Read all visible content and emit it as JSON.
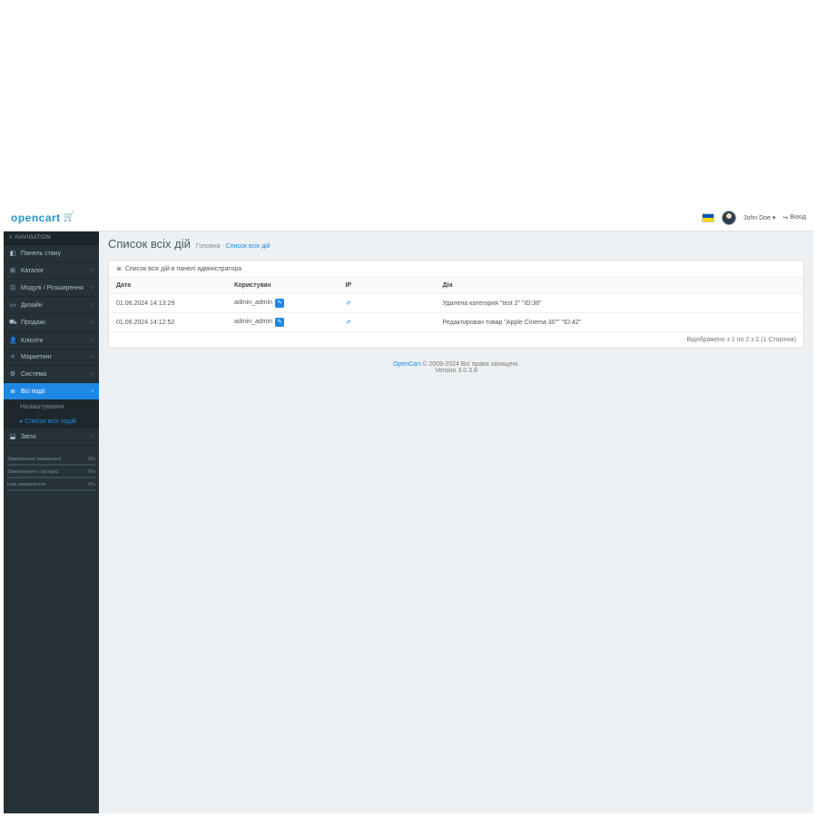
{
  "logo": "opencart",
  "user": {
    "name": "John Doe",
    "exit": "Вихід"
  },
  "nav_header": "NAVIGATION",
  "sidebar": [
    {
      "icon": "◧",
      "label": "Панель стану",
      "expandable": false,
      "key": "dashboard"
    },
    {
      "icon": "⊞",
      "label": "Каталог",
      "expandable": true,
      "key": "catalog"
    },
    {
      "icon": "⊡",
      "label": "Модулі / Розширення",
      "expandable": true,
      "key": "extensions"
    },
    {
      "icon": "▭",
      "label": "Дизайн",
      "expandable": true,
      "key": "design"
    },
    {
      "icon": "⛟",
      "label": "Продажі",
      "expandable": true,
      "key": "sales"
    },
    {
      "icon": "👤",
      "label": "Клієнти",
      "expandable": true,
      "key": "customers"
    },
    {
      "icon": "<",
      "label": "Маркетинг",
      "expandable": true,
      "key": "marketing"
    },
    {
      "icon": "⚙",
      "label": "Система",
      "expandable": true,
      "key": "system"
    },
    {
      "icon": "≣",
      "label": "Всі події",
      "expandable": true,
      "key": "allevents",
      "active": true
    },
    {
      "icon": "⬓",
      "label": "Звіти",
      "expandable": true,
      "key": "reports"
    }
  ],
  "submenu": [
    {
      "label": "Налаштування",
      "active": false,
      "key": "settings"
    },
    {
      "label": "Список всіх подій",
      "active": true,
      "key": "eventlist"
    }
  ],
  "stats": [
    {
      "label": "Замовлення завершені",
      "value": "0%"
    },
    {
      "label": "Замовлення у процесі",
      "value": "0%"
    },
    {
      "label": "Інші замовлення",
      "value": "0%"
    }
  ],
  "page": {
    "title": "Список всіх дій",
    "bc_home": "Головна",
    "bc_sep": " · ",
    "bc_current": "Список всіх дій"
  },
  "panel": {
    "head": "Список всіх дій в панелі адміністратора",
    "columns": {
      "date": "Дата",
      "user": "Користувач",
      "ip": "IP",
      "action": "Дія"
    },
    "rows": [
      {
        "date": "01.06.2024 14:13:29",
        "user": "admin_admin",
        "action": "Удалена категория \"test 2\" \"ID:36\""
      },
      {
        "date": "01.06.2024 14:12:52",
        "user": "admin_admin",
        "action": "Редактирован товар \"Apple Cinema 30\"\" \"ID:42\""
      }
    ],
    "pagination": "Відображено з 1 по 2 з 2 (1 Сторінок)"
  },
  "footer": {
    "brand": "OpenCart",
    "copyright": " © 2009-2024 Всі права захищені.",
    "version": "Version 3.0.3.8"
  }
}
